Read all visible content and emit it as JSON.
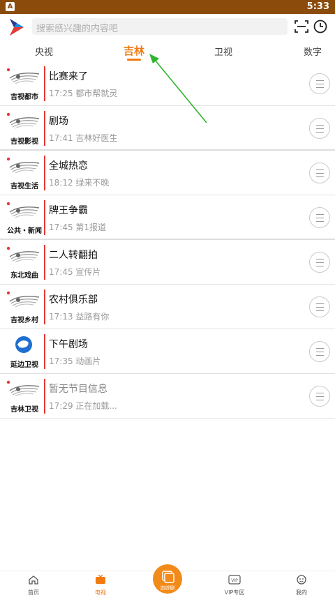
{
  "status": {
    "app_icon": "A",
    "time": "5:33"
  },
  "search": {
    "placeholder": "搜索感兴趣的内容吧"
  },
  "icons": {
    "logo": "play-triangle-logo",
    "scan": "scan-icon",
    "clock": "clock-icon"
  },
  "tabs": [
    {
      "label": "央视"
    },
    {
      "label": "吉林",
      "active": true
    },
    {
      "label": "卫视"
    },
    {
      "label": "数字"
    }
  ],
  "channels": [
    {
      "name": "吉视都市",
      "program": "比赛来了",
      "time": "17:25",
      "next": "都市帮就灵"
    },
    {
      "name": "吉视影视",
      "program": "剧场",
      "time": "17:41",
      "next": "吉林好医生"
    },
    {
      "name": "吉视生活",
      "program": "全城热恋",
      "time": "18:12",
      "next": "绿来不晚"
    },
    {
      "name": "公共・新闻",
      "program": "牌王争霸",
      "time": "17:45",
      "next": "第1报道"
    },
    {
      "name": "东北戏曲",
      "program": "二人转翻拍",
      "time": "17:45",
      "next": "宣传片"
    },
    {
      "name": "吉视乡村",
      "program": "农村俱乐部",
      "time": "17:13",
      "next": "益路有你"
    },
    {
      "name": "延边卫视",
      "program": "下午剧场",
      "time": "17:35",
      "next": "动画片"
    },
    {
      "name": "吉林卫视",
      "program": "暂无节目信息",
      "time": "17:29",
      "next": "正在加载..."
    }
  ],
  "bottom_nav": {
    "home": "首页",
    "tv": "电视",
    "center": "追综剧",
    "vip": "VIP专区",
    "mine": "我的"
  },
  "colors": {
    "accent": "#f07a10",
    "status_bar": "#8a4b0b",
    "divider_red": "#e53935",
    "annotation_arrow": "#2db52d"
  }
}
